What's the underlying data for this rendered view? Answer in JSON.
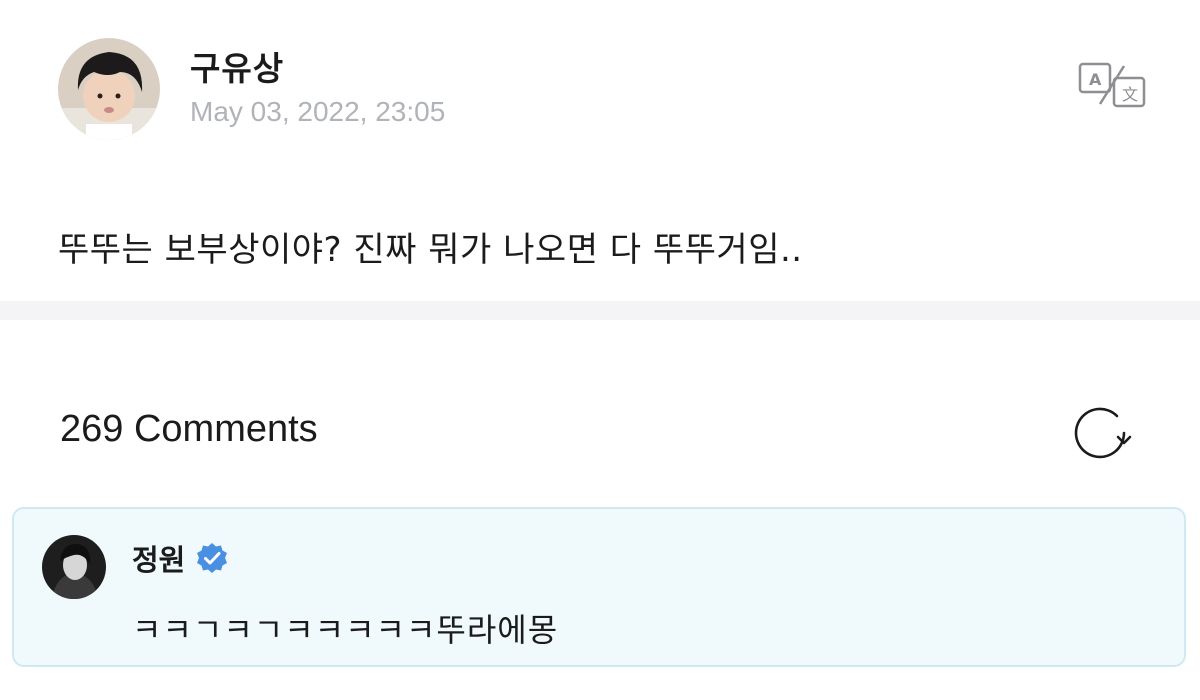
{
  "post": {
    "author": "구유상",
    "timestamp": "May 03, 2022, 23:05",
    "body": "뚜뚜는 보부상이야? 진짜 뭐가 나오면 다 뚜뚜거임..",
    "translate_icon": "translate-icon"
  },
  "comments": {
    "title": "269 Comments",
    "refresh_icon": "refresh-icon",
    "items": [
      {
        "author": "정원",
        "verified": true,
        "text": "ㅋㅋㄱㅋㄱㅋㅋㅋㅋㅋ뚜라에몽"
      }
    ]
  },
  "colors": {
    "timestamp": "#b0b3b8",
    "divider": "#f4f4f7",
    "comment_bg": "#f0f9fc",
    "comment_border": "#cfe9f1",
    "verified": "#4a90e2"
  }
}
